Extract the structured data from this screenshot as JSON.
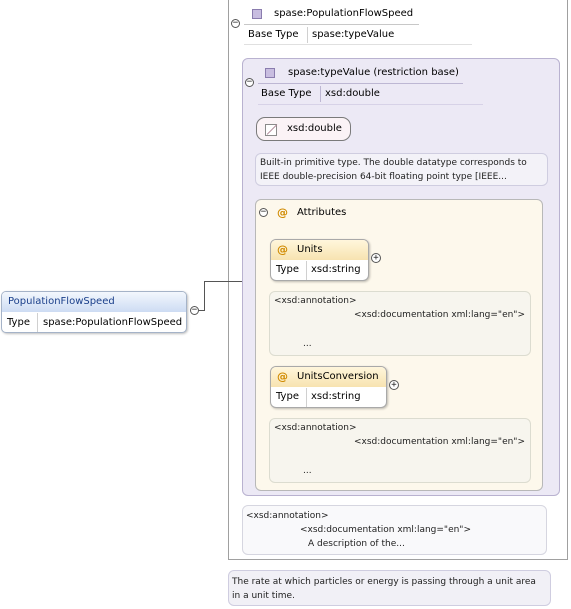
{
  "outer_type": {
    "name": "spase:PopulationFlowSpeed",
    "base_type_label": "Base Type",
    "base_type_value": "spase:typeValue"
  },
  "restriction": {
    "name": "spase:typeValue (restriction base)",
    "base_type_label": "Base Type",
    "base_type_value": "xsd:double",
    "primitive_badge": "xsd:double",
    "primitive_doc_line1": "Built-in primitive type. The double datatype corresponds to",
    "primitive_doc_line2": "IEEE double-precision 64-bit floating point type [IEEE..."
  },
  "attributes_group": {
    "label": "Attributes",
    "items": [
      {
        "name": "Units",
        "type_label": "Type",
        "type_value": "xsd:string",
        "annotation_line1": "<xsd:annotation>",
        "annotation_line2": "<xsd:documentation xml:lang=\"en\">",
        "annotation_line3": "..."
      },
      {
        "name": "UnitsConversion",
        "type_label": "Type",
        "type_value": "xsd:string",
        "annotation_line1": "<xsd:annotation>",
        "annotation_line2": "<xsd:documentation xml:lang=\"en\">",
        "annotation_line3": "..."
      }
    ]
  },
  "type_annotation": {
    "line1": "<xsd:annotation>",
    "line2": "<xsd:documentation xml:lang=\"en\">",
    "line3": "A description of the..."
  },
  "element": {
    "name": "PopulationFlowSpeed",
    "type_label": "Type",
    "type_value": "spase:PopulationFlowSpeed"
  },
  "element_doc": {
    "line1": "The rate at which particles or energy is passing through a unit area",
    "line2": "in a unit time."
  },
  "symbols": {
    "collapse": "−",
    "expand": "+",
    "attribute_marker": "@"
  }
}
